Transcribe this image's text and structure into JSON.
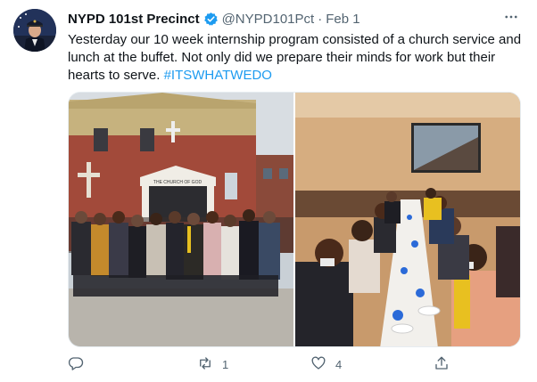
{
  "tweet": {
    "author_name": "NYPD 101st Precinct",
    "handle": "@NYPD101Pct",
    "separator": "·",
    "date": "Feb 1",
    "text_main": "Yesterday our 10 week internship program consisted of a church service and lunch at the buffet. Not only did we prepare their minds for work but their hearts to serve.",
    "hashtag": "#ITSWHATWEDO",
    "sign_text": "THE CHURCH OF GOD"
  },
  "actions": {
    "reply_count": "",
    "retweet_count": "1",
    "like_count": "4"
  },
  "icons": {
    "verified": "verified-badge-icon",
    "more": "more-options-icon",
    "reply": "reply-icon",
    "retweet": "retweet-icon",
    "like": "heart-icon",
    "share": "share-icon"
  },
  "colors": {
    "accent": "#1d9bf0",
    "text": "#0f1419",
    "secondary": "#536471"
  }
}
